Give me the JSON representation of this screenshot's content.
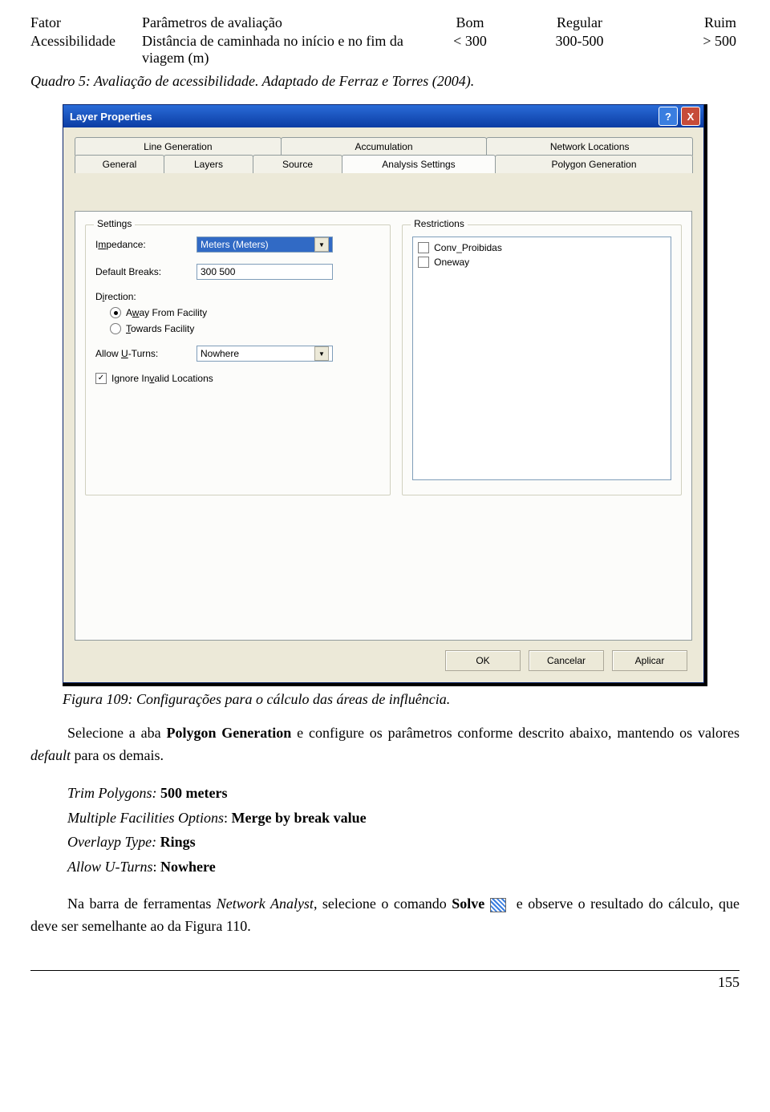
{
  "table": {
    "headers": [
      "Fator",
      "Parâmetros de avaliação",
      "Bom",
      "Regular",
      "Ruim"
    ],
    "row": {
      "fator": "Acessibilidade",
      "param": "Distância de caminhada no início e no fim da viagem (m)",
      "bom": "< 300",
      "reg": "300-500",
      "ruim": "> 500"
    }
  },
  "caption_quadro": "Quadro 5: Avaliação de acessibilidade. Adaptado de Ferraz e Torres (2004).",
  "dialog": {
    "title": "Layer Properties",
    "help": "?",
    "close": "X",
    "tabs_back": [
      "Line Generation",
      "Accumulation",
      "Network Locations"
    ],
    "tabs_front": [
      "General",
      "Layers",
      "Source",
      "Analysis Settings",
      "Polygon Generation"
    ],
    "settings_legend": "Settings",
    "restrictions_legend": "Restrictions",
    "impedance_label": "Impedance:",
    "impedance_value": "Meters (Meters)",
    "breaks_label": "Default Breaks:",
    "breaks_value": "300 500",
    "direction_label": "Direction:",
    "direction_opt1": "Away From Facility",
    "direction_opt2": "Towards Facility",
    "uturns_label": "Allow U-Turns:",
    "uturns_value": "Nowhere",
    "ignore_label": "Ignore Invalid Locations",
    "restriction_items": [
      "Conv_Proibidas",
      "Oneway"
    ],
    "buttons": {
      "ok": "OK",
      "cancel": "Cancelar",
      "apply": "Aplicar"
    }
  },
  "caption_figura": "Figura 109: Configurações para o cálculo das áreas de influência.",
  "para1_a": "Selecione a aba ",
  "para1_b": "Polygon Generation",
  "para1_c": " e configure os parâmetros conforme descrito abaixo, mantendo os valores ",
  "para1_d": "default",
  "para1_e": " para os demais.",
  "line1_a": "Trim Polygons: ",
  "line1_b": "500 meters",
  "line2_a": "Multiple Facilities Options",
  "line2_b": ": ",
  "line2_c": "Merge by break value",
  "line3_a": "Overlayp Type: ",
  "line3_b": "Rings",
  "line4_a": "Allow U-Turns",
  "line4_b": ": ",
  "line4_c": "Nowhere",
  "para2_a": "Na barra de ferramentas ",
  "para2_b": "Network Analyst",
  "para2_c": ", selecione o comando ",
  "para2_d": "Solve",
  "para2_e": " e observe o resultado do cálculo, que deve ser semelhante ao da Figura 110.",
  "page_number": "155"
}
